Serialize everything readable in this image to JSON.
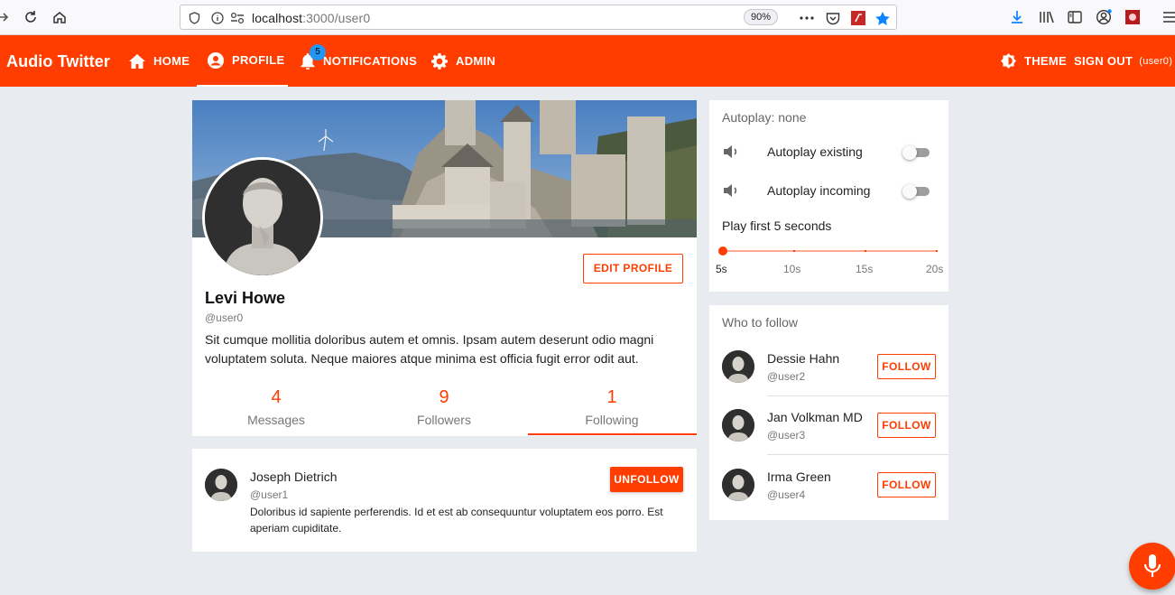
{
  "browser": {
    "url_host": "localhost",
    "url_rest": ":3000/user0",
    "zoom": "90%"
  },
  "appbar": {
    "brand": "Audio Twitter",
    "home": "HOME",
    "profile": "PROFILE",
    "notifications": "NOTIFICATIONS",
    "notifications_count": "5",
    "admin": "ADMIN",
    "theme": "THEME",
    "signout": "SIGN OUT",
    "signout_user": "(user0)"
  },
  "profile": {
    "name": "Levi Howe",
    "handle": "@user0",
    "bio": "Sit cumque mollitia doloribus autem et omnis. Ipsam autem deserunt odio magni voluptatem soluta. Neque maiores atque minima est officia fugit error odit aut.",
    "edit_label": "EDIT PROFILE",
    "stats": [
      {
        "value": "4",
        "label": "Messages"
      },
      {
        "value": "9",
        "label": "Followers"
      },
      {
        "value": "1",
        "label": "Following"
      }
    ],
    "selected_tab": "Following"
  },
  "following": {
    "name": "Joseph Dietrich",
    "handle": "@user1",
    "text": "Doloribus id sapiente perferendis. Id et est ab consequuntur voluptatem eos porro. Est aperiam cupiditate.",
    "button": "UNFOLLOW"
  },
  "autoplay": {
    "title": "Autoplay: none",
    "existing_label": "Autoplay existing",
    "existing_on": false,
    "incoming_label": "Autoplay incoming",
    "incoming_on": false,
    "play_first_label": "Play first 5 seconds",
    "slider_value_seconds": 5,
    "slider_marks": [
      "5s",
      "10s",
      "15s",
      "20s"
    ]
  },
  "who_to_follow": {
    "title": "Who to follow",
    "follow_label": "FOLLOW",
    "users": [
      {
        "name": "Dessie Hahn",
        "handle": "@user2"
      },
      {
        "name": "Jan Volkman MD",
        "handle": "@user3"
      },
      {
        "name": "Irma Green",
        "handle": "@user4"
      }
    ]
  },
  "colors": {
    "accent": "#ff3d00",
    "badge": "#2196f3",
    "background": "#e8ebef"
  }
}
